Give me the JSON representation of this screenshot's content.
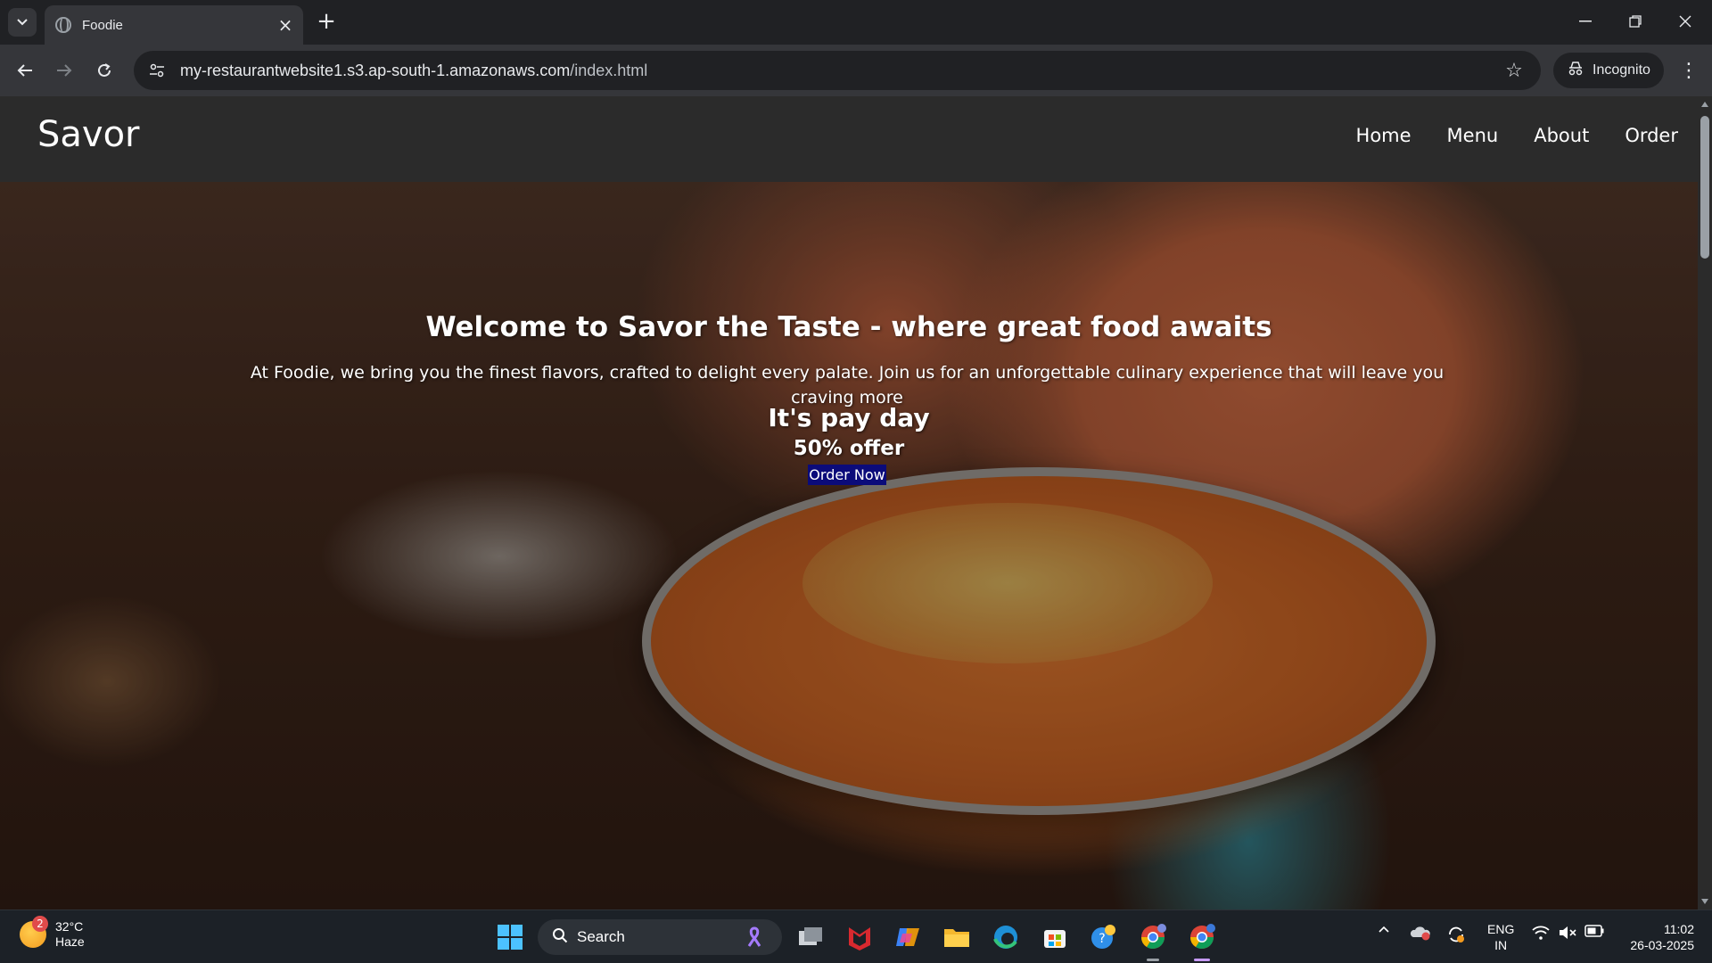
{
  "browser": {
    "tab_title": "Foodie",
    "new_tab_symbol": "+",
    "url_host": "my-restaurantwebsite1.s3.ap-south-1.amazonaws.com",
    "url_path": "/index.html",
    "incognito_label": "Incognito"
  },
  "site": {
    "logo": "Savor",
    "nav": [
      "Home",
      "Menu",
      "About",
      "Order"
    ],
    "hero": {
      "title": "Welcome to Savor the Taste - where great food awaits",
      "text": "At Foodie, we bring you the finest flavors, crafted to delight every palate. Join us for an unforgettable culinary experience that will leave you craving more",
      "offer_line1": "It's pay day",
      "offer_line2": "50% offer",
      "cta": "Order Now"
    }
  },
  "taskbar": {
    "weather_badge": "2",
    "temperature": "32°C",
    "condition": "Haze",
    "search_label": "Search",
    "lang_line1": "ENG",
    "lang_line2": "IN",
    "time": "11:02",
    "date": "26-03-2025"
  },
  "colors": {
    "cta_bg": "#0b0b7a",
    "header_bg": "#2b2b2b",
    "accent_windows": "#4cc2ff"
  }
}
